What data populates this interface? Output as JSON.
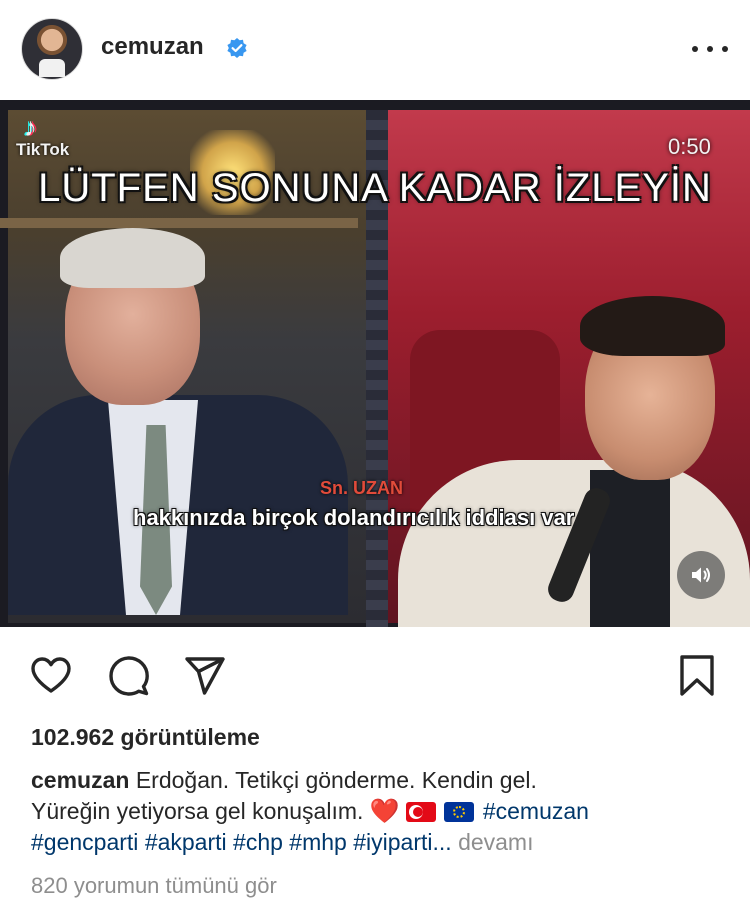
{
  "post": {
    "username": "cemuzan",
    "verified": true,
    "more_icon": "more-dots-icon"
  },
  "media": {
    "watermark_logo": "♪",
    "watermark_text": "TikTok",
    "timer": "0:50",
    "overlay_title": "LÜTFEN SONUNA KADAR İZLEYİN",
    "speaker_label": "Sn. UZAN",
    "subtitle": "hakkınızda birçok dolandırıcılık iddiası var",
    "sound_icon": "speaker-icon"
  },
  "actions": {
    "like_icon": "heart-icon",
    "comment_icon": "comment-icon",
    "share_icon": "send-icon",
    "save_icon": "bookmark-icon"
  },
  "views": "102.962 görüntüleme",
  "caption": {
    "username": "cemuzan",
    "line1": "Erdoğan. Tetikçi gönderme. Kendin gel.",
    "line2": "Yüreğin yetiyorsa gel konuşalım.",
    "emoji_heart": "❤️",
    "flags": [
      "turkey-flag",
      "eu-flag"
    ],
    "hashtags_line2": [
      "#cemuzan"
    ],
    "hashtags_line3": [
      "#gencparti",
      "#akparti",
      "#chp",
      "#mhp",
      "#iyiparti..."
    ],
    "more": "devamı"
  },
  "comments_link": "820 yorumun tümünü gör",
  "colors": {
    "text": "#262626",
    "secondary": "#8e8e8e",
    "hashtag": "#00376b",
    "verified": "#3897f0"
  }
}
